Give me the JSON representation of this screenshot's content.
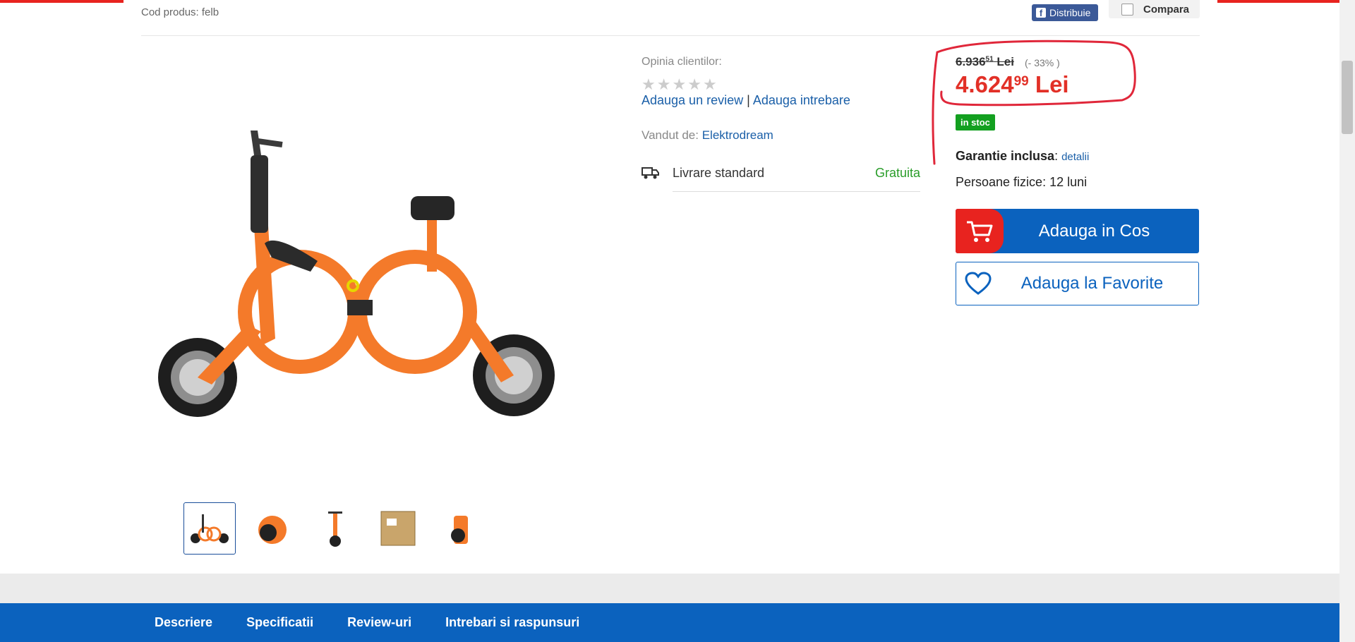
{
  "header": {
    "product_code": "Cod produs: felb",
    "share_label": "Distribuie",
    "compare_label": "Compara"
  },
  "gallery": {
    "thumb_count": 5
  },
  "reviews": {
    "label": "Opinia clientilor:",
    "rating_stars": 0,
    "add_review": "Adauga un review",
    "separator": "|",
    "add_question": "Adauga intrebare"
  },
  "seller": {
    "label": "Vandut de:",
    "name": "Elektrodream"
  },
  "delivery": {
    "label": "Livrare standard",
    "price": "Gratuita"
  },
  "price": {
    "old_main": "6.936",
    "old_cents": "51",
    "old_currency": "Lei",
    "discount": "(- 33% )",
    "new_main": "4.624",
    "new_cents": "99",
    "new_currency": "Lei",
    "stock": "in stoc"
  },
  "warranty": {
    "label": "Garantie inclusa",
    "details": "detalii",
    "individuals": "Persoane fizice: 12 luni"
  },
  "actions": {
    "add_to_cart": "Adauga in Cos",
    "add_to_favorites": "Adauga la Favorite"
  },
  "bottom_nav": {
    "tabs": [
      "Descriere",
      "Specificatii",
      "Review-uri",
      "Intrebari si raspunsuri"
    ]
  },
  "colors": {
    "brand_blue": "#0b62be",
    "accent_red": "#e8231f",
    "price_red": "#e23027",
    "stock_green": "#13a020",
    "bike_orange": "#f47a2a"
  }
}
